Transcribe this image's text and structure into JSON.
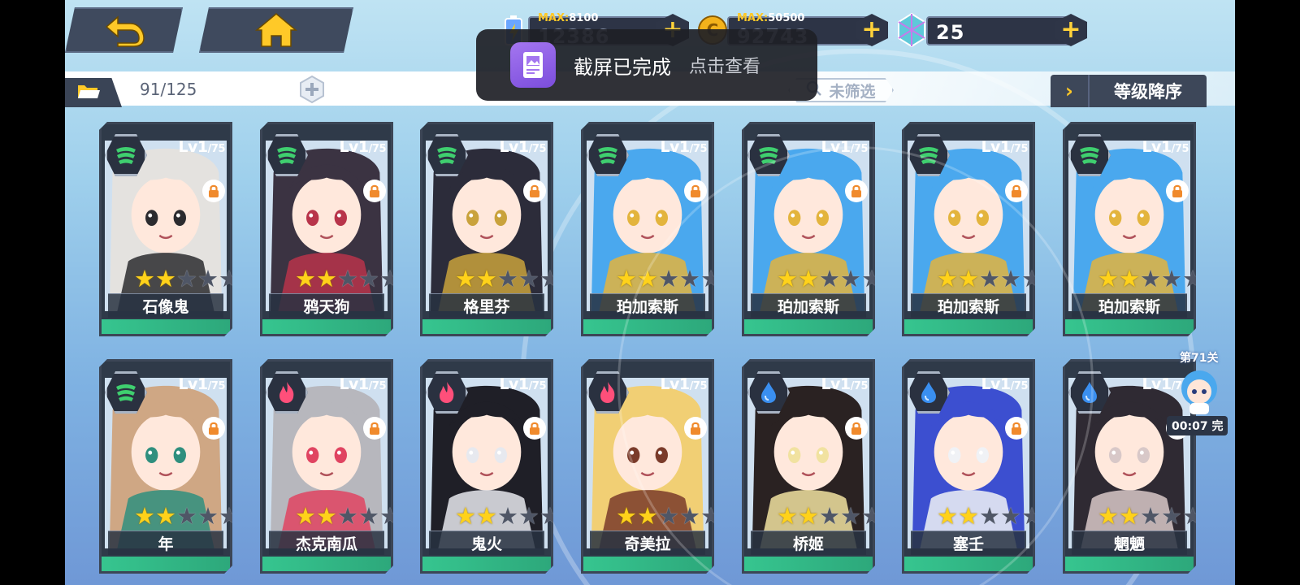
{
  "header": {
    "back_icon": "back-arrow-icon",
    "home_icon": "home-icon",
    "resources": [
      {
        "id": "stamina",
        "icon": "battery-icon",
        "max_label": "MAX:",
        "max_value": "8100",
        "value": "12386"
      },
      {
        "id": "coins",
        "icon": "coin-icon",
        "max_label": "MAX:",
        "max_value": "50500",
        "value": "92743"
      },
      {
        "id": "gems",
        "icon": "gem-icon",
        "max_label": "",
        "max_value": "",
        "value": "25"
      }
    ]
  },
  "toolbar": {
    "count": "91/125",
    "filter_label": "未筛选",
    "sort_label": "等级降序",
    "sort_arrow": "›"
  },
  "toast": {
    "title": "截屏已完成",
    "action": "点击查看"
  },
  "cards": [
    {
      "name": "石像鬼",
      "level": "Lv1",
      "max": "/75",
      "element": "wind",
      "stars": 2,
      "hair": "#e4e2df",
      "accent": "#2b2b2f"
    },
    {
      "name": "鸦天狗",
      "level": "Lv1",
      "max": "/75",
      "element": "wind",
      "stars": 2,
      "hair": "#3b3342",
      "accent": "#b8344a"
    },
    {
      "name": "格里芬",
      "level": "Lv1",
      "max": "/75",
      "element": "wind",
      "stars": 2,
      "hair": "#2c2c3a",
      "accent": "#c9a23c"
    },
    {
      "name": "珀加索斯",
      "level": "Lv1",
      "max": "/75",
      "element": "wind",
      "stars": 2,
      "hair": "#4aa8ee",
      "accent": "#e3b43d"
    },
    {
      "name": "珀加索斯",
      "level": "Lv1",
      "max": "/75",
      "element": "wind",
      "stars": 2,
      "hair": "#4aa8ee",
      "accent": "#e3b43d"
    },
    {
      "name": "珀加索斯",
      "level": "Lv1",
      "max": "/75",
      "element": "wind",
      "stars": 2,
      "hair": "#4aa8ee",
      "accent": "#e3b43d"
    },
    {
      "name": "珀加索斯",
      "level": "Lv1",
      "max": "/75",
      "element": "wind",
      "stars": 2,
      "hair": "#4aa8ee",
      "accent": "#e3b43d"
    },
    {
      "name": "年",
      "level": "Lv1",
      "max": "/75",
      "element": "wind",
      "stars": 2,
      "hair": "#cfa784",
      "accent": "#2f8f7e"
    },
    {
      "name": "杰克南瓜",
      "level": "Lv1",
      "max": "/75",
      "element": "fire",
      "stars": 2,
      "hair": "#b7b7bd",
      "accent": "#e04461"
    },
    {
      "name": "鬼火",
      "level": "Lv1",
      "max": "/75",
      "element": "fire",
      "stars": 2,
      "hair": "#1f1f27",
      "accent": "#e7e9ef"
    },
    {
      "name": "奇美拉",
      "level": "Lv1",
      "max": "/75",
      "element": "fire",
      "stars": 2,
      "hair": "#f1cf74",
      "accent": "#7a3b2a"
    },
    {
      "name": "桥姬",
      "level": "Lv1",
      "max": "/75",
      "element": "water",
      "stars": 2,
      "hair": "#2a2222",
      "accent": "#f1e2a0"
    },
    {
      "name": "塞壬",
      "level": "Lv1",
      "max": "/75",
      "element": "water",
      "stars": 2,
      "hair": "#3c4fd0",
      "accent": "#f0f2f6"
    },
    {
      "name": "魍魉",
      "level": "Lv1",
      "max": "/75",
      "element": "water",
      "stars": 2,
      "hair": "#2f2a33",
      "accent": "#d8c8c8"
    }
  ],
  "side_badge": {
    "stage_label": "第71关",
    "timer": "00:07 完"
  },
  "colors": {
    "wind": "#3fcf6f",
    "fire": "#ff4f7a",
    "water": "#3a8ff0",
    "star_on": "#ffd21a",
    "accent_gold": "#ffc928"
  }
}
